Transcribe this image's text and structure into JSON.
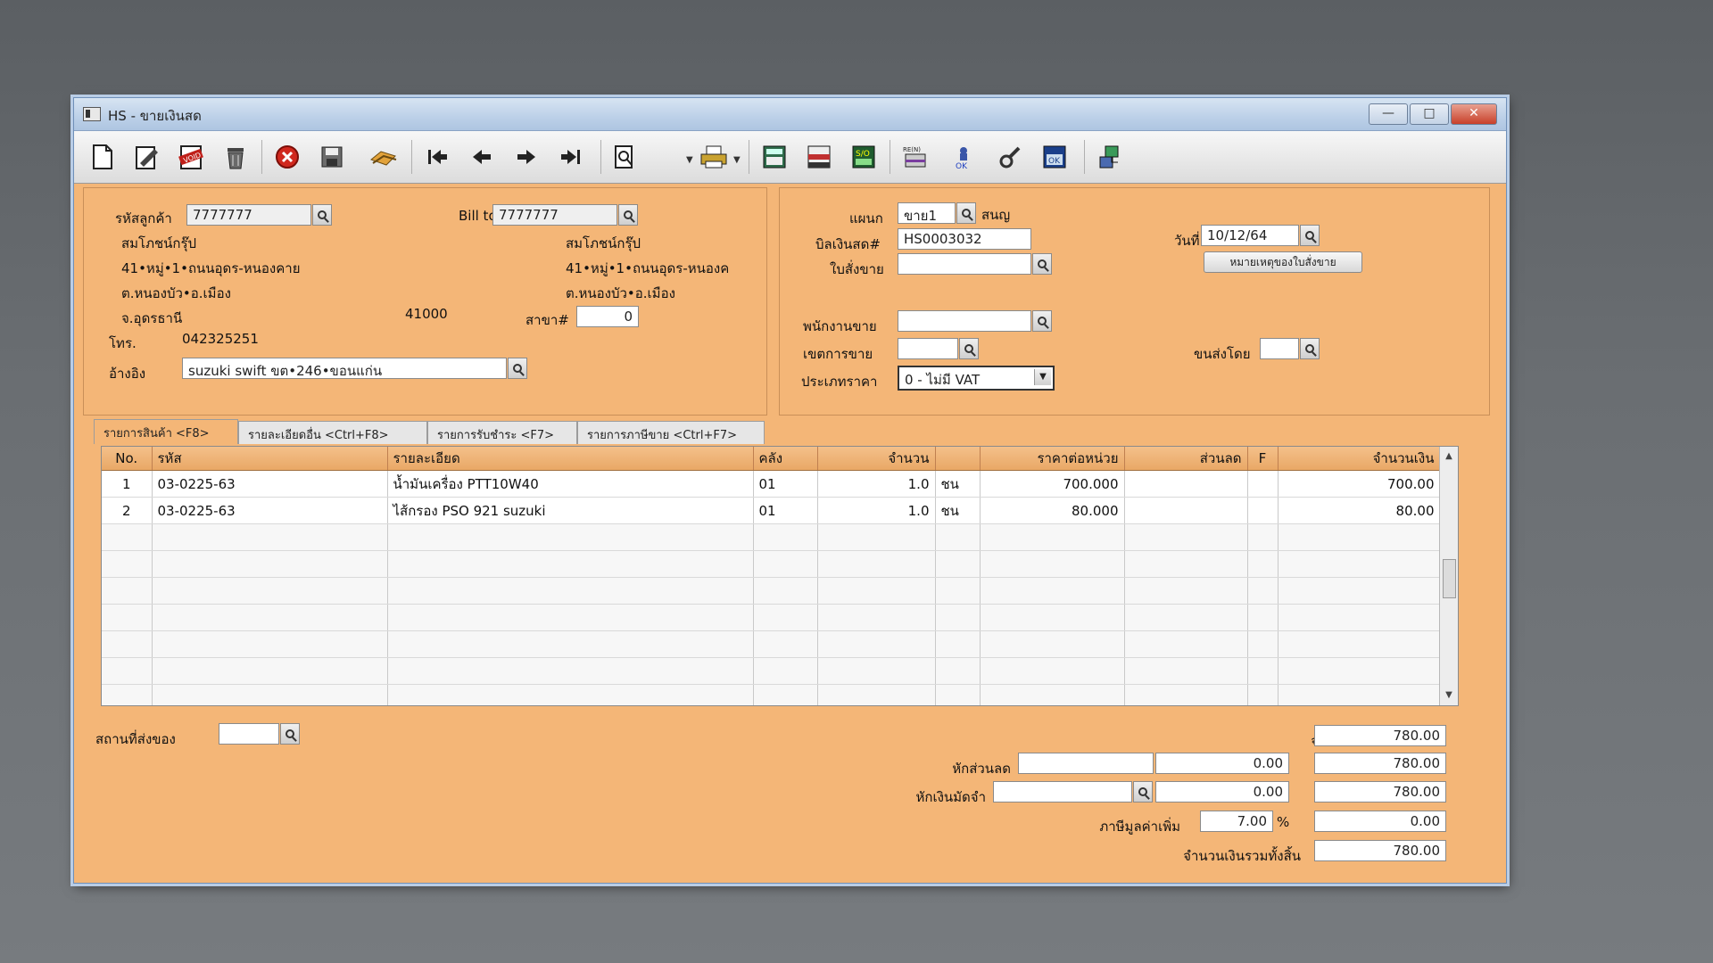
{
  "window": {
    "title": "HS - ขายเงินสด",
    "controls": {
      "minimize": "—",
      "maximize": "□",
      "close": "✕"
    }
  },
  "toolbar": {
    "icons": [
      "new-doc-icon",
      "edit-icon",
      "void-icon",
      "trash-icon",
      "cancel-icon",
      "save-icon",
      "receive-icon",
      "first-record-icon",
      "prev-record-icon",
      "next-record-icon",
      "last-record-icon",
      "preview-icon",
      "print-icon",
      "calc-icon",
      "report-icon",
      "so-icon",
      "return-icon",
      "approve-icon",
      "tool-icon",
      "ok-icon",
      "network-icon"
    ]
  },
  "customer": {
    "code_label": "รหัสลูกค้า",
    "code": "7777777",
    "name": "สมโภชน์กรุ๊ป",
    "addr1": "41•หมู่•1•ถนนอุดร-หนองคาย",
    "addr2": "ต.หนองบัว•อ.เมือง",
    "addr3": "จ.อุดรธานี",
    "zip": "41000",
    "tel_label": "โทร.",
    "tel": "042325251",
    "ref_label": "อ้างอิง",
    "ref": "suzuki swift ขต•246•ขอนแก่น"
  },
  "billto": {
    "label": "Bill to",
    "code": "7777777",
    "name": "สมโภชน์กรุ๊ป",
    "addr1": "41•หมู่•1•ถนนอุดร-หนองค",
    "addr2": "ต.หนองบัว•อ.เมือง",
    "branch_label": "สาขา#",
    "branch": "0"
  },
  "doc": {
    "dept_label": "แผนก",
    "dept": "ขาย1",
    "dept_name": "สนญ",
    "bill_label": "บิลเงินสด#",
    "bill_no": "HS0003032",
    "so_label": "ใบสั่งขาย",
    "so": "",
    "date_label": "วันที่",
    "date": "10/12/64",
    "note_button": "หมายเหตุของใบสั่งขาย",
    "salesman_label": "พนักงานขาย",
    "salesman": "",
    "area_label": "เขตการขาย",
    "area": "",
    "shipby_label": "ขนส่งโดย",
    "shipby": "",
    "pricetype_label": "ประเภทราคา",
    "pricetype": "0 - ไม่มี VAT"
  },
  "tabs": [
    {
      "label": "รายการสินค้า <F8>",
      "active": true
    },
    {
      "label": "รายละเอียดอื่น <Ctrl+F8>",
      "active": false
    },
    {
      "label": "รายการรับชำระ <F7>",
      "active": false
    },
    {
      "label": "รายการภาษีขาย <Ctrl+F7>",
      "active": false
    }
  ],
  "grid": {
    "columns": [
      "No.",
      "รหัส",
      "รายละเอียด",
      "คลัง",
      "จำนวน",
      "",
      "ราคาต่อหน่วย",
      "ส่วนลด",
      "F",
      "จำนวนเงิน"
    ],
    "rows": [
      [
        "1",
        "03-0225-63",
        "น้ำมันเครื่อง PTT10W40",
        "01",
        "1.0",
        "ชน",
        "700.000",
        "",
        "",
        "700.00"
      ],
      [
        "2",
        "03-0225-63",
        "ไส้กรอง PSO 921 suzuki",
        "01",
        "1.0",
        "ชน",
        "80.000",
        "",
        "",
        "80.00"
      ]
    ],
    "empty_rows": 7
  },
  "footer": {
    "delivery_label": "สถานที่ส่งของ",
    "delivery": "",
    "amount_label": "จำนวนเงิน",
    "amount": "780.00",
    "discount_label": "หักส่วนลด",
    "discount_input": "",
    "discount": "0.00",
    "after_discount": "780.00",
    "deposit_label": "หักเงินมัดจำ",
    "deposit_input": "",
    "deposit": "0.00",
    "after_deposit": "780.00",
    "vat_label": "ภาษีมูลค่าเพิ่ม",
    "vat_rate": "7.00",
    "vat_pct": "%",
    "vat_amount": "0.00",
    "total_label": "จำนวนเงินรวมทั้งสิ้น",
    "total": "780.00"
  }
}
